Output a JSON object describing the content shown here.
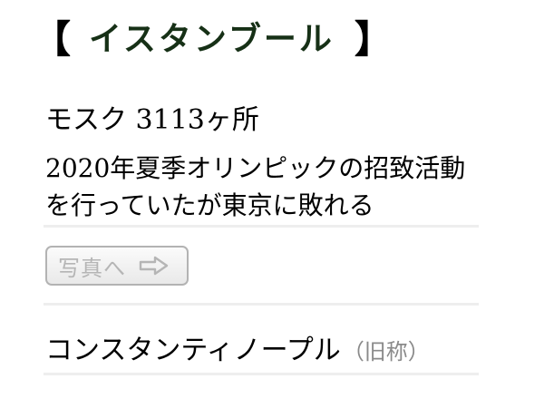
{
  "header": {
    "left_bracket": "【",
    "title": "イスタンブール",
    "right_bracket": "】"
  },
  "facts": {
    "mosques": "モスク 3113ヶ所",
    "olympic_line1": "2020年夏季オリンピックの招致活動",
    "olympic_line2": "を行っていたが東京に敗れる"
  },
  "photo_button": {
    "label": "写真へ",
    "icon": "right-arrow-icon"
  },
  "former_name": {
    "name": "コンスタンティノープル",
    "note": "（旧称）"
  },
  "colors": {
    "title": "#163016",
    "button_text": "#b5b5b5",
    "button_border": "#b3b3b3",
    "divider": "#eeeeee",
    "note": "#8a8a8a"
  }
}
